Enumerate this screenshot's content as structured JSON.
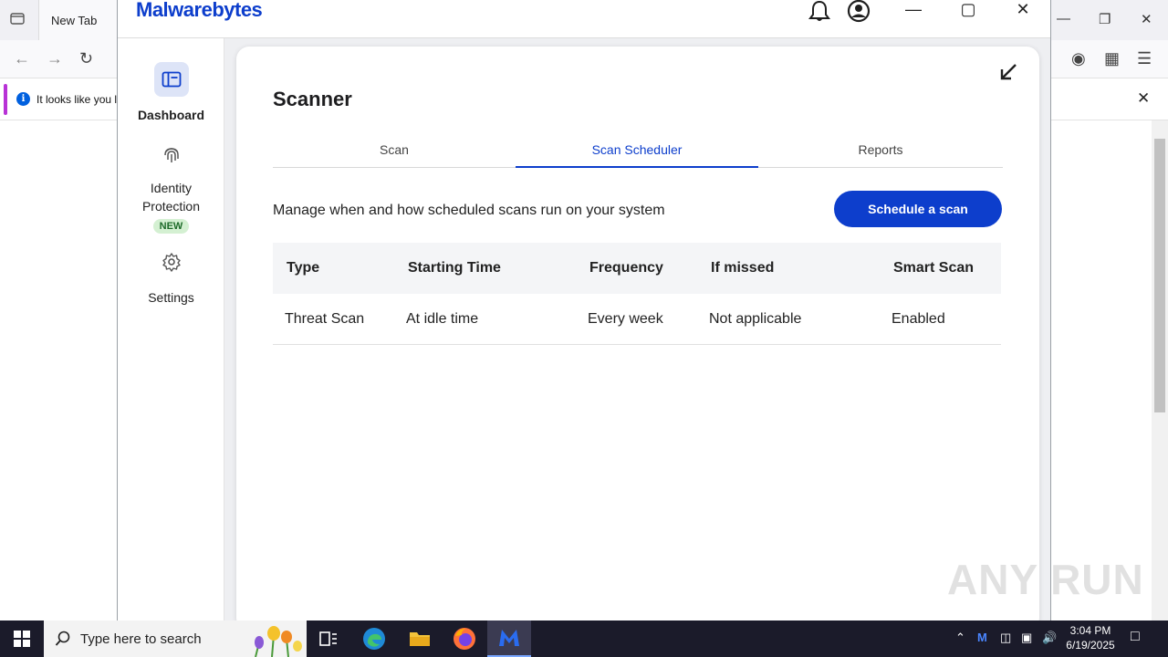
{
  "browser": {
    "tab_label": "New Tab",
    "notification_text": "It looks like you l"
  },
  "app": {
    "logo_text": "Malwarebytes",
    "title_icons": [
      "bell-icon",
      "account-icon"
    ],
    "window_controls": [
      "minimize",
      "maximize",
      "close"
    ]
  },
  "sidebar": {
    "items": [
      {
        "label": "Dashboard",
        "icon": "dashboard-icon",
        "active": true
      },
      {
        "label": "Identity Protection",
        "icon": "fingerprint-icon",
        "badge": "NEW"
      },
      {
        "label": "Settings",
        "icon": "gear-icon"
      }
    ]
  },
  "scanner": {
    "title": "Scanner",
    "tabs": [
      {
        "label": "Scan"
      },
      {
        "label": "Scan Scheduler",
        "active": true
      },
      {
        "label": "Reports"
      }
    ],
    "description": "Manage when and how scheduled scans run on your system",
    "schedule_button": "Schedule a scan",
    "table": {
      "headers": [
        "Type",
        "Starting Time",
        "Frequency",
        "If missed",
        "Smart Scan"
      ],
      "rows": [
        [
          "Threat Scan",
          "At idle time",
          "Every week",
          "Not applicable",
          "Enabled"
        ]
      ]
    }
  },
  "taskbar": {
    "search_placeholder": "Type here to search",
    "time": "3:04 PM",
    "date": "6/19/2025"
  },
  "watermark": "ANY RUN",
  "colors": {
    "accent": "#0d3ecc",
    "badge_bg": "#d4f0d2",
    "taskbar": "#1b1b2a"
  }
}
